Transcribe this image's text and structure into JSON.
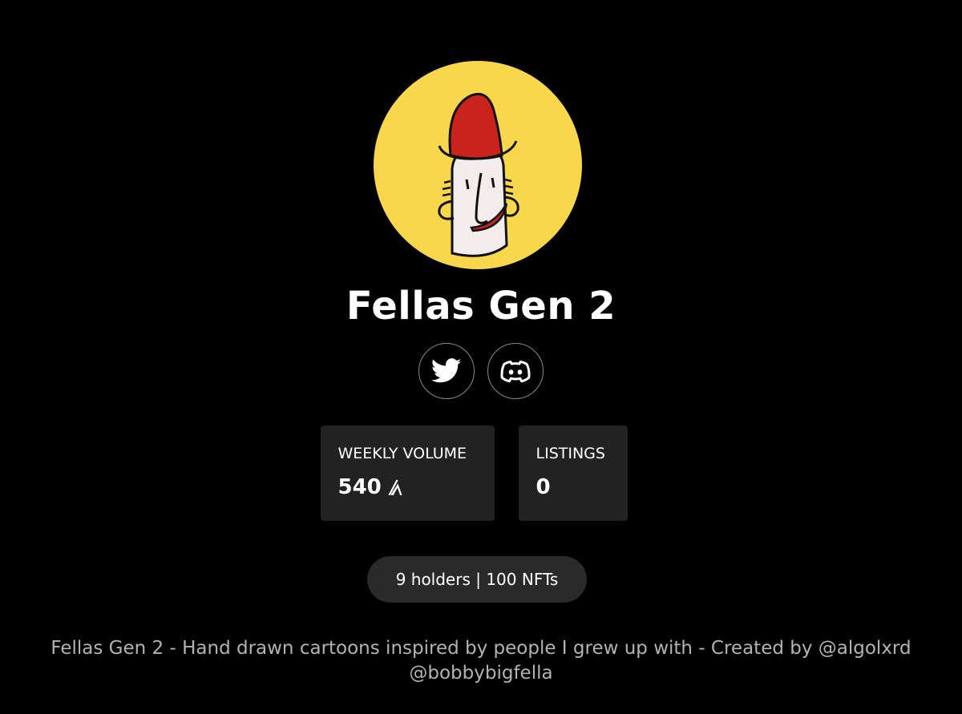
{
  "collection": {
    "name": "Fellas Gen 2",
    "avatar_icon": "cartoon-fella-avatar"
  },
  "socials": [
    {
      "name": "twitter",
      "icon": "twitter-bird-icon"
    },
    {
      "name": "discord",
      "icon": "discord-icon"
    }
  ],
  "stats": {
    "weekly_volume": {
      "label": "WEEKLY VOLUME",
      "value": "540",
      "currency_icon": "algorand-icon"
    },
    "listings": {
      "label": "LISTINGS",
      "value": "0"
    }
  },
  "holders_summary": "9 holders | 100 NFTs",
  "description": "Fellas Gen 2 - Hand drawn cartoons inspired by people I grew up with - Created by @algolxrd @bobbybigfella",
  "colors": {
    "background": "#000000",
    "card": "#222222",
    "avatar_bg": "#F9D74C",
    "hat": "#C9231B"
  }
}
